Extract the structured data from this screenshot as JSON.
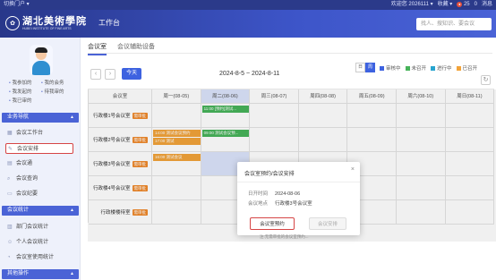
{
  "util": {
    "portal": "切换门户 ▾",
    "welcome": "欢迎您 2026111 ▾",
    "favorites": "收藏 ▾",
    "count": "25",
    "unread": "0",
    "notify": "消息"
  },
  "header": {
    "logo_cn": "湖北美術學院",
    "logo_en": "HUBEI INSTITUTE OF FINE ARTS",
    "nav_tab": "工作台",
    "search_placeholder": "找人、搜知识、要会议"
  },
  "sidebar": {
    "quick": [
      "我参加的",
      "我的会务",
      "我发起的",
      "待我审的",
      "我已审的"
    ],
    "sections": [
      {
        "label": "业务导航",
        "items": [
          "会议工作台",
          "会议安排",
          "会议通",
          "会议查询",
          "会议纪要"
        ]
      },
      {
        "label": "会议统计",
        "items": [
          "部门会议统计",
          "个人会议统计",
          "会议室使用统计"
        ]
      },
      {
        "label": "其他操作",
        "items": []
      }
    ]
  },
  "tabs": [
    "会议室",
    "会议辅助设备"
  ],
  "toolbar": {
    "today": "今天",
    "range": "2024-8-5 ~ 2024-8-11",
    "view_day": "日",
    "view_week": "周"
  },
  "legend": [
    {
      "label": "审核中",
      "color": "#3d62e0"
    },
    {
      "label": "未召开",
      "color": "#47b35a"
    },
    {
      "label": "进行中",
      "color": "#27a4cf"
    },
    {
      "label": "已召开",
      "color": "#f2a33a"
    }
  ],
  "grid": {
    "room_header": "会议室",
    "days": [
      "周一(08-05)",
      "周二(08-06)",
      "周三(08-07)",
      "周四(08-08)",
      "周五(08-09)",
      "周六(08-10)",
      "周日(08-11)"
    ],
    "rooms": [
      {
        "name": "行政楼1号会议室",
        "badge": "需审批"
      },
      {
        "name": "行政楼2号会议室",
        "badge": "需审批"
      },
      {
        "name": "行政楼3号会议室",
        "badge": "需审批"
      },
      {
        "name": "行政楼4号会议室",
        "badge": "需审批"
      },
      {
        "name": "行政楼楼待室",
        "badge": "需审批"
      }
    ],
    "events": [
      {
        "text": "11:00 [预约]测试...",
        "room": 0,
        "day": 1,
        "slot": 0,
        "color": "#47b35a"
      },
      {
        "text": "14:00 测试会议预约",
        "room": 1,
        "day": 0,
        "slot": 0,
        "color": "#f2a33a"
      },
      {
        "text": "17:00 测试",
        "room": 1,
        "day": 0,
        "slot": 1,
        "color": "#f2a33a"
      },
      {
        "text": "09:00 测试会议预...",
        "room": 1,
        "day": 1,
        "slot": 0,
        "color": "#47b35a"
      },
      {
        "text": "16:00 测试会议",
        "room": 2,
        "day": 0,
        "slot": 0,
        "color": "#f2a33a"
      }
    ]
  },
  "dialog": {
    "title": "会议室预约/会议安排",
    "date_label": "日开时间",
    "date_value": "2024-08-06",
    "place_label": "会议地点",
    "place_value": "行政楼3号会议室",
    "primary": "会议室预约",
    "secondary": "会议安排"
  },
  "hint": "注:无需审批的会议室预约..."
}
